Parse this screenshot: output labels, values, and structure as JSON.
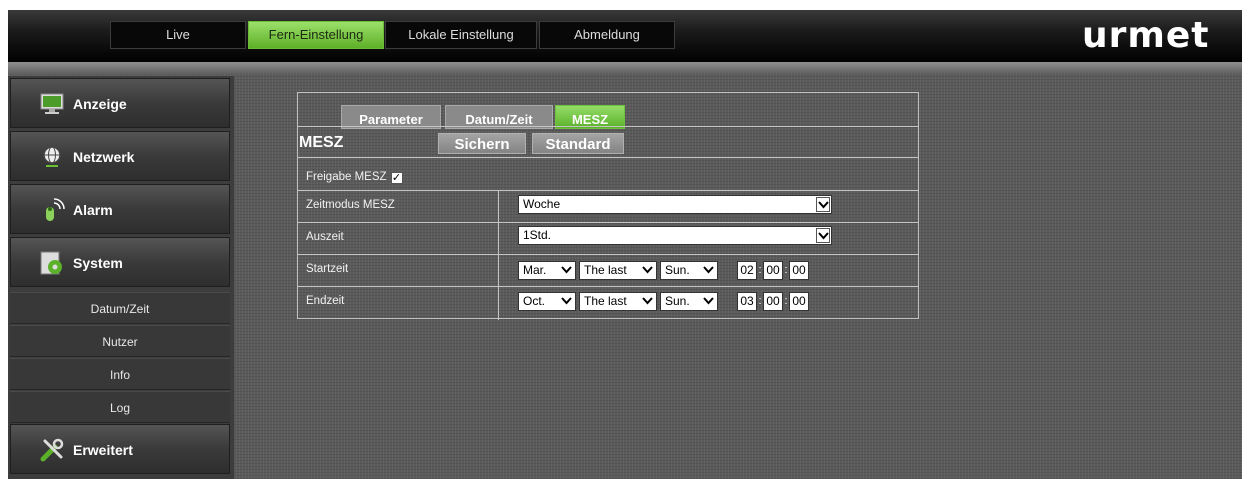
{
  "topnav": {
    "live": "Live",
    "remote_settings": "Fern-Einstellung",
    "local_settings": "Lokale Einstellung",
    "logout": "Abmeldung"
  },
  "brand": {
    "logo_text": "urmet"
  },
  "sidebar": {
    "display": "Anzeige",
    "network": "Netzwerk",
    "alarm": "Alarm",
    "system": "System",
    "sub_items": [
      "Datum/Zeit",
      "Nutzer",
      "Info",
      "Log"
    ],
    "advanced": "Erweitert"
  },
  "tabs": {
    "parameter": "Parameter",
    "date_time": "Datum/Zeit",
    "dst": "MESZ"
  },
  "section": {
    "title": "MESZ",
    "save_label": "Sichern",
    "default_label": "Standard"
  },
  "form": {
    "enable_label": "Freigabe MESZ",
    "enable_checked": true,
    "time_mode_label": "Zeitmodus MESZ",
    "time_mode_value": "Woche",
    "offset_label": "Auszeit",
    "offset_value": "1Std.",
    "start_label": "Startzeit",
    "start_month": "Mar.",
    "start_week": "The last",
    "start_day": "Sun.",
    "start_hour": "02",
    "start_min": "00",
    "start_sec": "00",
    "end_label": "Endzeit",
    "end_month": "Oct.",
    "end_week": "The last",
    "end_day": "Sun.",
    "end_hour": "03",
    "end_min": "00",
    "end_sec": "00"
  },
  "colors": {
    "accent_green": "#6bbf35",
    "panel_bg": "#5b5b5b"
  }
}
